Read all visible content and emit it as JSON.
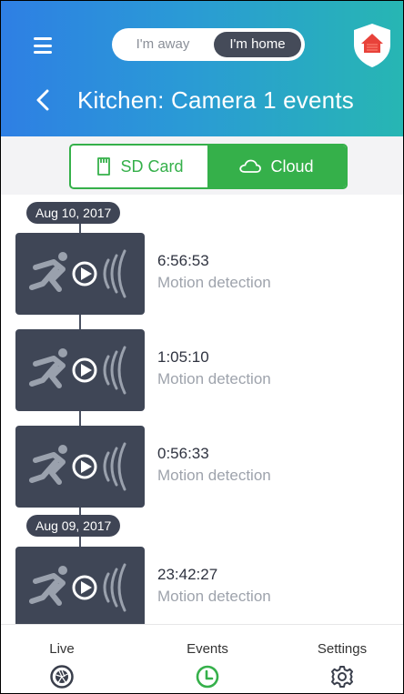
{
  "header": {
    "mode_away": "I'm away",
    "mode_home": "I'm home",
    "active_mode": "I'm home",
    "title": "Kitchen: Camera 1 events",
    "icons": {
      "menu": "hamburger-icon",
      "back": "chevron-left-icon",
      "logo": "shield-house-icon"
    }
  },
  "storage_tabs": [
    {
      "label": "SD Card",
      "icon": "sd-card-icon",
      "selected": false
    },
    {
      "label": "Cloud",
      "icon": "cloud-icon",
      "selected": true
    }
  ],
  "timeline": {
    "groups": [
      {
        "date": "Aug 10, 2017",
        "events": [
          {
            "time": "6:56:53",
            "type": "Motion detection"
          },
          {
            "time": "1:05:10",
            "type": "Motion detection"
          },
          {
            "time": "0:56:33",
            "type": "Motion detection"
          }
        ]
      },
      {
        "date": "Aug 09, 2017",
        "events": [
          {
            "time": "23:42:27",
            "type": "Motion detection"
          }
        ]
      }
    ]
  },
  "bottom_nav": [
    {
      "label": "Live",
      "icon": "camera-aperture-icon",
      "active": false
    },
    {
      "label": "Events",
      "icon": "clock-icon",
      "active": true
    },
    {
      "label": "Settings",
      "icon": "gear-icon",
      "active": false
    }
  ],
  "colors": {
    "header_gradient_start": "#2e7fe4",
    "header_gradient_end": "#27b6b3",
    "accent_green": "#35b04a",
    "thumbnail_bg": "#3f4656",
    "logo_red": "#e8423a"
  }
}
